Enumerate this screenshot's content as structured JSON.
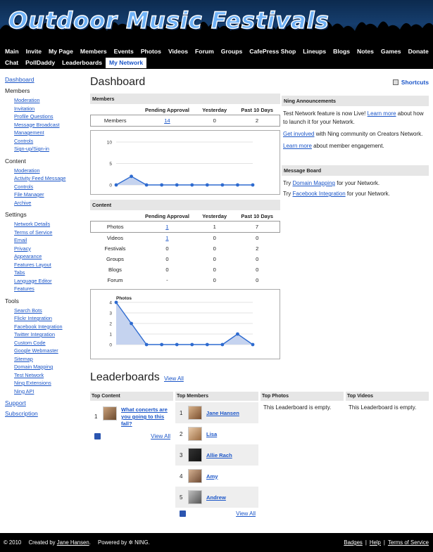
{
  "site": {
    "title": "Outdoor Music Festivals"
  },
  "nav": {
    "row1": [
      "Main",
      "Invite",
      "My Page",
      "Members",
      "Events",
      "Photos",
      "Videos",
      "Forum",
      "Groups",
      "CafePress Shop",
      "Lineups",
      "Blogs",
      "Notes",
      "Games",
      "Donate"
    ],
    "row2": [
      "Chat",
      "PollDaddy",
      "Leaderboards",
      "My Network"
    ],
    "active": "My Network"
  },
  "sidebar": {
    "dashboard": "Dashboard",
    "groups": [
      {
        "title": "Members",
        "items": [
          "Moderation",
          "Invitation",
          "Profile Questions",
          "Message Broadcast",
          "Management",
          "Controls",
          "Sign-up/Sign-in"
        ]
      },
      {
        "title": "Content",
        "items": [
          "Moderation",
          "Activity Feed Message",
          "Controls",
          "File Manager",
          "Archive"
        ]
      },
      {
        "title": "Settings",
        "items": [
          "Network Details",
          "Terms of Service",
          "Email",
          "Privacy",
          "Appearance",
          "Features Layout",
          "Tabs",
          "Language Editor",
          "Features"
        ]
      },
      {
        "title": "Tools",
        "items": [
          "Search Bots",
          "Flickr Integration",
          "Facebook Integration",
          "Twitter Integration",
          "Custom Code",
          "Google Webmaster",
          "Sitemap",
          "Domain Mapping",
          "Test Network",
          "Ning Extensions",
          "Ning API"
        ]
      }
    ],
    "support": "Support",
    "subscription": "Subscription"
  },
  "dashboard": {
    "title": "Dashboard",
    "shortcuts": "Shortcuts",
    "members": {
      "section": "Members",
      "headers": [
        "",
        "Pending Approval",
        "Yesterday",
        "Past 10 Days"
      ],
      "row": {
        "label": "Members",
        "pending": "14",
        "yesterday": "0",
        "past10": "2"
      }
    },
    "content": {
      "section": "Content",
      "headers": [
        "",
        "Pending Approval",
        "Yesterday",
        "Past 10 Days"
      ],
      "rows": [
        {
          "label": "Photos",
          "pending": "1",
          "yesterday": "1",
          "past10": "7"
        },
        {
          "label": "Videos",
          "pending": "1",
          "yesterday": "0",
          "past10": "0"
        },
        {
          "label": "Festivals",
          "pending": "0",
          "yesterday": "0",
          "past10": "2"
        },
        {
          "label": "Groups",
          "pending": "0",
          "yesterday": "0",
          "past10": "0"
        },
        {
          "label": "Blogs",
          "pending": "0",
          "yesterday": "0",
          "past10": "0"
        },
        {
          "label": "Forum",
          "pending": "-",
          "yesterday": "0",
          "past10": "0"
        }
      ]
    }
  },
  "chart_data": [
    {
      "type": "area",
      "title": "",
      "x": [
        1,
        2,
        3,
        4,
        5,
        6,
        7,
        8,
        9,
        10
      ],
      "series": [
        {
          "values": [
            0,
            2,
            0,
            0,
            0,
            0,
            0,
            0,
            0,
            0
          ]
        }
      ],
      "ylim": [
        0,
        10
      ],
      "yticks": [
        0,
        5,
        10
      ],
      "grid": true,
      "color": "#2e6bd0"
    },
    {
      "type": "area",
      "title": "Photos",
      "x": [
        1,
        2,
        3,
        4,
        5,
        6,
        7,
        8,
        9,
        10
      ],
      "series": [
        {
          "values": [
            4,
            2,
            0,
            0,
            0,
            0,
            0,
            0,
            1,
            0
          ]
        }
      ],
      "ylim": [
        0,
        4
      ],
      "yticks": [
        0,
        1,
        2,
        3,
        4
      ],
      "grid": true,
      "color": "#2e6bd0"
    }
  ],
  "announcements": {
    "title": "Ning Announcements",
    "p1_text": "Test Network feature is now Live!",
    "p1_link": "Learn more",
    "p1_after": "about how to launch it for your Network.",
    "p2_link": "Get involved",
    "p2_after": "with Ning community on Creators Network.",
    "p3_link": "Learn more",
    "p3_after": "about member engagement."
  },
  "message_board": {
    "title": "Message Board",
    "try": "Try",
    "l1_link": "Domain Mapping",
    "l1_after": "for your Network.",
    "l2_link": "Facebook Integration",
    "l2_after": "for your Network."
  },
  "leaderboards": {
    "title": "Leaderboards",
    "view_all": "View All",
    "top_content": {
      "title": "Top Content",
      "items": [
        {
          "rank": "1",
          "title": "What concerts are you going to this fall?"
        }
      ],
      "view_all": "View All"
    },
    "top_members": {
      "title": "Top Members",
      "items": [
        {
          "rank": "1",
          "name": "Jane Hansen"
        },
        {
          "rank": "2",
          "name": "Lisa"
        },
        {
          "rank": "3",
          "name": "Allie Rach"
        },
        {
          "rank": "4",
          "name": "Amy"
        },
        {
          "rank": "5",
          "name": "Andrew"
        }
      ],
      "view_all": "View All"
    },
    "top_photos": {
      "title": "Top Photos",
      "empty": "This Leaderboard is empty."
    },
    "top_videos": {
      "title": "Top Videos",
      "empty": "This Leaderboard is empty."
    }
  },
  "footer": {
    "copyright": "© 2010",
    "created_by": "Created by",
    "creator": "Jane Hansen",
    "powered_by": "Powered by",
    "ning": "NING.",
    "links": [
      "Badges",
      "Help",
      "Terms of Service"
    ]
  }
}
